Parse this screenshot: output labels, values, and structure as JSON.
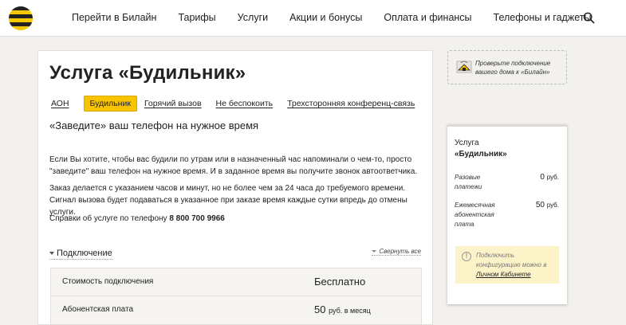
{
  "header": {
    "nav": [
      "Перейти в Билайн",
      "Тарифы",
      "Услуги",
      "Акции и бонусы",
      "Оплата и финансы",
      "Телефоны и гаджеты"
    ]
  },
  "main": {
    "title": "Услуга «Будильник»",
    "tabs": [
      "АОН",
      "Будильник",
      "Горячий вызов",
      "Не беспокоить",
      "Трехсторонняя конференц-связь"
    ],
    "subtitle": "«Заведите» ваш телефон на нужное время",
    "para1": "Если Вы хотите, чтобы вас будили по утрам или в назначенный час напоминали о чем-то, просто \"заведите\" ваш телефон на нужное время. И в заданное время вы получите звонок автоответчика.",
    "para2": "Заказ делается с указанием часов и минут, но не более чем за 24 часа до требуемого времени. Сигнал вызова будет подаваться в указанное при заказе время каждые сутки впредь до отмены услуги.",
    "para3_prefix": "Справки об услуге по телефону ",
    "para3_phone": "8 800 700 9966",
    "connection_label": "Подключение",
    "collapse_all": "Свернуть все",
    "table": [
      {
        "label": "Стоимость подключения",
        "value": "Бесплатно",
        "unit": ""
      },
      {
        "label": "Абонентская плата",
        "value": "50",
        "unit": "руб. в месяц"
      }
    ]
  },
  "check": {
    "text": "Проверьте подключение вашего дома к «Билайн»"
  },
  "side": {
    "title_line1": "Услуга",
    "title_line2": "«Будильник»",
    "rows": [
      {
        "label_l1": "Разовые",
        "label_l2": "платежи",
        "label_l3": "",
        "value": "0",
        "unit": "руб."
      },
      {
        "label_l1": "Ежемесячная",
        "label_l2": "абонентская",
        "label_l3": "плата",
        "value": "50",
        "unit": "руб."
      }
    ],
    "note_line1": "Подключить",
    "note_line2": "конфигурацию можно в",
    "note_link": "Личном Кабинете"
  },
  "colors": {
    "brand_yellow": "#f8c400",
    "note_bg": "#fdf3c9"
  },
  "icons": [
    "beeline-logo-icon",
    "search-icon",
    "house-wifi-icon",
    "info-circle-icon",
    "triangle-down-icon"
  ]
}
